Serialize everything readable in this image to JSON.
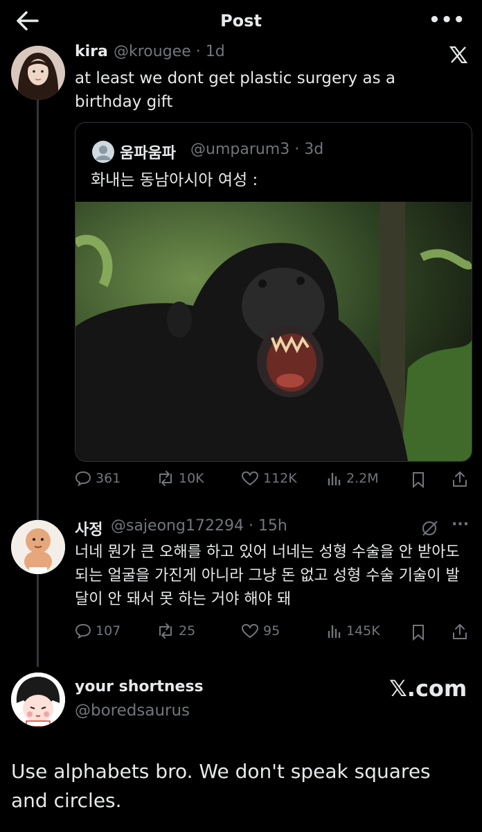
{
  "header": {
    "title": "Post",
    "more": "•••"
  },
  "post1": {
    "name": "kira",
    "handle": "@krougee",
    "time": "· 1d",
    "text": "at least we dont get plastic surgery as a birthday gift",
    "x_icon": "x-logo-icon",
    "quote": {
      "name": "움파움파",
      "handle": "@umparum3",
      "time": "· 3d",
      "text": "화내는 동남아시아 여성 :"
    },
    "actions": {
      "replies": "361",
      "reposts": "10K",
      "likes": "112K",
      "views": "2.2M"
    }
  },
  "post2": {
    "name": "사정",
    "handle": "@sajeong172294",
    "time": "· 15h",
    "text": "너네 뭔가 큰 오해를 하고 있어 너네는 성형 수술을 안 받아도 되는 얼굴을 가진게 아니라 그냥 돈 없고 성형 수술 기술이 발달이 안 돼서 못 하는 거야 해야 돼",
    "more": "···",
    "actions": {
      "replies": "107",
      "reposts": "25",
      "likes": "95",
      "views": "145K"
    }
  },
  "post3": {
    "name": "your shortness",
    "handle": "@boredsaurus",
    "watermark": "𝕏.com",
    "text": "Use alphabets bro. We don't speak squares and circles."
  },
  "colors": {
    "background": "#000000",
    "text": "#e7e9ea",
    "muted": "#71767b",
    "border": "#2f3336"
  }
}
